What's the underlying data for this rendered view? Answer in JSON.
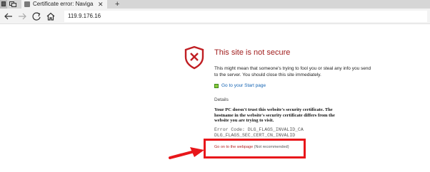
{
  "browser": {
    "tab_title": "Certificate error: Naviga",
    "tab_close_glyph": "✕",
    "new_tab_glyph": "+",
    "address": "119.9.176.16"
  },
  "page": {
    "heading": "This site is not secure",
    "description": "This might mean that someone's trying to fool you or steal any info you send to the server. You should close this site immediately.",
    "start_link": "Go to your Start page",
    "details_label": "Details",
    "details_text": "Your PC doesn't trust this website's security certificate. The hostname in the website's security certificate differs from the website you are trying to visit.",
    "error_code": "Error Code: DLG_FLAGS_INVALID_CA\nDLG_FLAGS_SEC_CERT_CN_INVALID",
    "go_on_link": "Go on to the webpage",
    "go_on_note": "(Not recommended)"
  },
  "colors": {
    "heading_red": "#a11e1e",
    "link_blue": "#1464b4",
    "annotation_red": "#e8161a"
  },
  "icons": {
    "shield": "shield-x-icon",
    "start": "start-page-icon",
    "back": "back-arrow-icon",
    "forward": "forward-arrow-icon",
    "refresh": "refresh-icon",
    "home": "home-icon"
  }
}
